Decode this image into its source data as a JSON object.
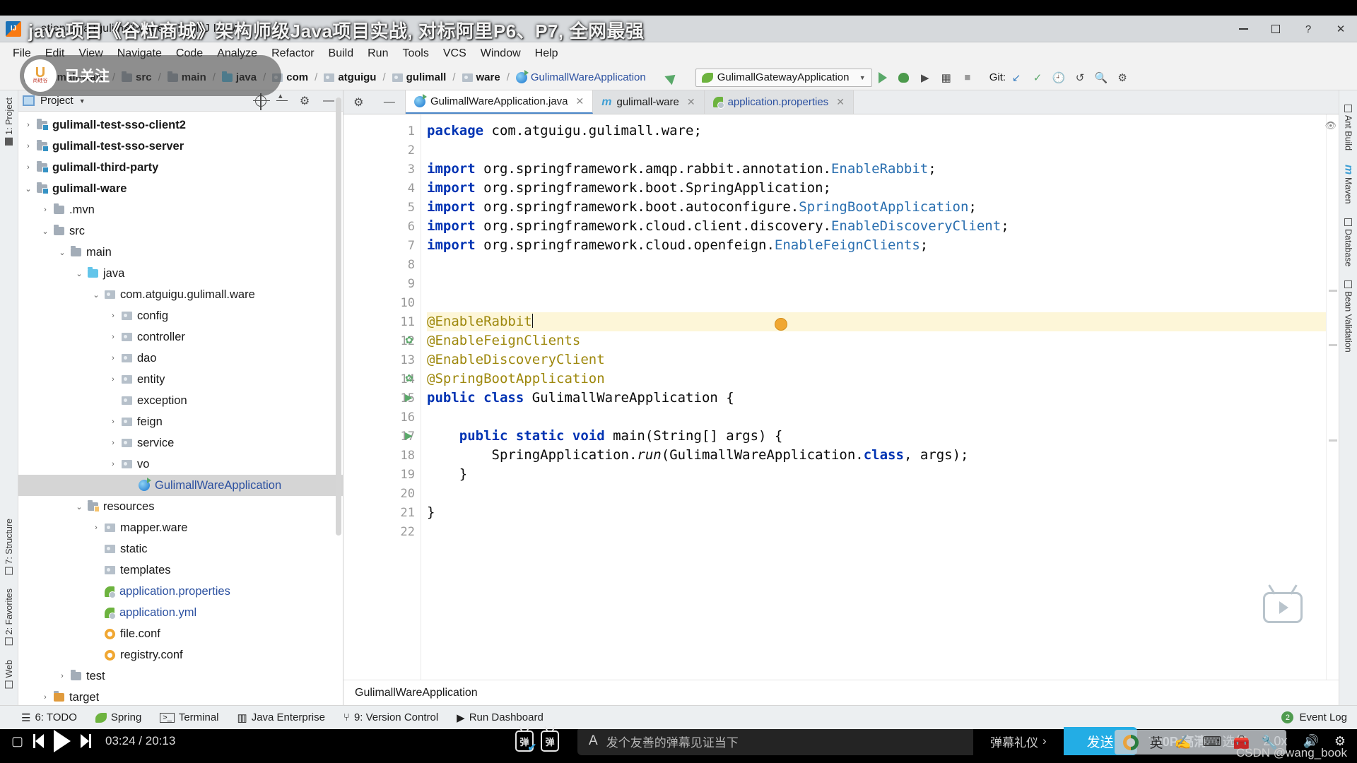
{
  "window": {
    "title": "...ation.java [gulimall-ware] - IntelliJ IDEA",
    "app_icon": "intellij-idea-logo",
    "minimize": "–",
    "maximize": "□",
    "help": "?",
    "close": "✕"
  },
  "menubar": {
    "items": [
      {
        "label": "File"
      },
      {
        "label": "Edit"
      },
      {
        "label": "View"
      },
      {
        "label": "Navigate"
      },
      {
        "label": "Code"
      },
      {
        "label": "Analyze"
      },
      {
        "label": "Refactor"
      },
      {
        "label": "Build"
      },
      {
        "label": "Run"
      },
      {
        "label": "Tools"
      },
      {
        "label": "VCS"
      },
      {
        "label": "Window"
      },
      {
        "label": "Help"
      }
    ]
  },
  "navbar": {
    "breadcrumbs": [
      {
        "label": "gulimall-ware",
        "icon": "module-folder-icon",
        "bold": true
      },
      {
        "label": "src",
        "icon": "folder-icon",
        "bold": true
      },
      {
        "label": "main",
        "icon": "folder-icon",
        "bold": true
      },
      {
        "label": "java",
        "icon": "source-folder-icon",
        "bold": true
      },
      {
        "label": "com",
        "icon": "package-icon",
        "bold": true
      },
      {
        "label": "atguigu",
        "icon": "package-icon",
        "bold": true
      },
      {
        "label": "gulimall",
        "icon": "package-icon",
        "bold": true
      },
      {
        "label": "ware",
        "icon": "package-icon",
        "bold": true
      },
      {
        "label": "GulimallWareApplication",
        "icon": "java-class-icon",
        "bold": false
      }
    ],
    "run_config": "GulimallGatewayApplication",
    "git_label": "Git:"
  },
  "project_panel": {
    "title": "Project",
    "tree": [
      {
        "label": "gulimall-test-sso-client2",
        "arrow": "collapsed",
        "indent": 1,
        "icon": "module-folder-icon",
        "bold": true
      },
      {
        "label": "gulimall-test-sso-server",
        "arrow": "collapsed",
        "indent": 1,
        "icon": "module-folder-icon",
        "bold": true
      },
      {
        "label": "gulimall-third-party",
        "arrow": "collapsed",
        "indent": 1,
        "icon": "module-folder-icon",
        "bold": true
      },
      {
        "label": "gulimall-ware",
        "arrow": "expanded",
        "indent": 1,
        "icon": "module-folder-icon",
        "bold": true
      },
      {
        "label": ".mvn",
        "arrow": "collapsed",
        "indent": 2,
        "icon": "folder-icon",
        "bold": false
      },
      {
        "label": "src",
        "arrow": "expanded",
        "indent": 2,
        "icon": "folder-icon",
        "bold": false
      },
      {
        "label": "main",
        "arrow": "expanded",
        "indent": 3,
        "icon": "folder-icon",
        "bold": false
      },
      {
        "label": "java",
        "arrow": "expanded",
        "indent": 4,
        "icon": "source-folder-icon",
        "bold": false
      },
      {
        "label": "com.atguigu.gulimall.ware",
        "arrow": "expanded",
        "indent": 5,
        "icon": "package-icon",
        "bold": false
      },
      {
        "label": "config",
        "arrow": "collapsed",
        "indent": 6,
        "icon": "package-icon",
        "bold": false
      },
      {
        "label": "controller",
        "arrow": "collapsed",
        "indent": 6,
        "icon": "package-icon",
        "bold": false
      },
      {
        "label": "dao",
        "arrow": "collapsed",
        "indent": 6,
        "icon": "package-icon",
        "bold": false
      },
      {
        "label": "entity",
        "arrow": "collapsed",
        "indent": 6,
        "icon": "package-icon",
        "bold": false
      },
      {
        "label": "exception",
        "arrow": "none",
        "indent": 6,
        "icon": "package-icon",
        "bold": false
      },
      {
        "label": "feign",
        "arrow": "collapsed",
        "indent": 6,
        "icon": "package-icon",
        "bold": false
      },
      {
        "label": "service",
        "arrow": "collapsed",
        "indent": 6,
        "icon": "package-icon",
        "bold": false
      },
      {
        "label": "vo",
        "arrow": "collapsed",
        "indent": 6,
        "icon": "package-icon",
        "bold": false
      },
      {
        "label": "GulimallWareApplication",
        "arrow": "none",
        "indent": 7,
        "icon": "java-class-icon",
        "bold": false,
        "selected": true,
        "link": true
      },
      {
        "label": "resources",
        "arrow": "expanded",
        "indent": 4,
        "icon": "resources-folder-icon",
        "bold": false
      },
      {
        "label": "mapper.ware",
        "arrow": "collapsed",
        "indent": 5,
        "icon": "package-icon",
        "bold": false
      },
      {
        "label": "static",
        "arrow": "none",
        "indent": 5,
        "icon": "package-icon",
        "bold": false
      },
      {
        "label": "templates",
        "arrow": "none",
        "indent": 5,
        "icon": "package-icon",
        "bold": false
      },
      {
        "label": "application.properties",
        "arrow": "none",
        "indent": 5,
        "icon": "spring-config-icon",
        "bold": false,
        "link": true
      },
      {
        "label": "application.yml",
        "arrow": "none",
        "indent": 5,
        "icon": "spring-config-icon",
        "bold": false,
        "link": true
      },
      {
        "label": "file.conf",
        "arrow": "none",
        "indent": 5,
        "icon": "conf-file-icon",
        "bold": false
      },
      {
        "label": "registry.conf",
        "arrow": "none",
        "indent": 5,
        "icon": "conf-file-icon",
        "bold": false
      },
      {
        "label": "test",
        "arrow": "collapsed",
        "indent": 3,
        "icon": "folder-icon",
        "bold": false
      },
      {
        "label": "target",
        "arrow": "collapsed",
        "indent": 2,
        "icon": "target-folder-icon",
        "bold": false
      }
    ]
  },
  "left_tool_strip": [
    {
      "label": "1: Project",
      "name": "tool-window-project"
    },
    {
      "label": "7: Structure",
      "name": "tool-window-structure"
    },
    {
      "label": "2: Favorites",
      "name": "tool-window-favorites"
    },
    {
      "label": "Web",
      "name": "tool-window-web"
    }
  ],
  "right_tool_strip": [
    {
      "label": "Ant Build",
      "name": "tool-window-ant-build"
    },
    {
      "label": "Maven",
      "name": "tool-window-maven"
    },
    {
      "label": "Database",
      "name": "tool-window-database"
    },
    {
      "label": "Bean Validation",
      "name": "tool-window-bean-validation"
    }
  ],
  "editor": {
    "tabs": [
      {
        "label": "GulimallWareApplication.java",
        "icon": "java-class-icon",
        "active": true,
        "closeable": true
      },
      {
        "label": "gulimall-ware",
        "icon": "maven-module-icon",
        "active": false,
        "closeable": true
      },
      {
        "label": "application.properties",
        "icon": "spring-config-icon",
        "active": false,
        "closeable": true,
        "link": true
      }
    ],
    "line_numbers": [
      "1",
      "2",
      "3",
      "4",
      "5",
      "6",
      "7",
      "8",
      "9",
      "10",
      "11",
      "12",
      "13",
      "14",
      "15",
      "16",
      "17",
      "18",
      "19",
      "20",
      "21",
      "22"
    ],
    "lines": [
      {
        "n": 1,
        "html": "<span class='kw'>package</span> com.atguigu.gulimall.ware;"
      },
      {
        "n": 2,
        "html": ""
      },
      {
        "n": 3,
        "html": "<span class='kw'>import</span> org.springframework.amqp.rabbit.annotation.<span class='cls'>EnableRabbit</span>;"
      },
      {
        "n": 4,
        "html": "<span class='kw'>import</span> org.springframework.boot.SpringApplication;"
      },
      {
        "n": 5,
        "html": "<span class='kw'>import</span> org.springframework.boot.autoconfigure.<span class='cls'>SpringBootApplication</span>;"
      },
      {
        "n": 6,
        "html": "<span class='kw'>import</span> org.springframework.cloud.client.discovery.<span class='cls'>EnableDiscoveryClient</span>;"
      },
      {
        "n": 7,
        "html": "<span class='kw'>import</span> org.springframework.cloud.openfeign.<span class='cls'>EnableFeignClients</span>;"
      },
      {
        "n": 8,
        "html": ""
      },
      {
        "n": 9,
        "html": ""
      },
      {
        "n": 10,
        "html": ""
      },
      {
        "n": 11,
        "html": "<span class='anno'>@EnableRabbit</span><span class='cursor'></span>",
        "highlight": true
      },
      {
        "n": 12,
        "html": "<span class='anno'>@EnableFeignClients</span>"
      },
      {
        "n": 13,
        "html": "<span class='anno'>@EnableDiscoveryClient</span>"
      },
      {
        "n": 14,
        "html": "<span class='anno'>@SpringBootApplication</span>"
      },
      {
        "n": 15,
        "html": "<span class='kw'>public class</span> GulimallWareApplication {"
      },
      {
        "n": 16,
        "html": ""
      },
      {
        "n": 17,
        "html": "    <span class='kw'>public static void</span> main(String[] args) {"
      },
      {
        "n": 18,
        "html": "        SpringApplication.<span class='it'>run</span>(GulimallWareApplication.<span class='kw'>class</span>, args);"
      },
      {
        "n": 19,
        "html": "    }"
      },
      {
        "n": 20,
        "html": ""
      },
      {
        "n": 21,
        "html": "}"
      },
      {
        "n": 22,
        "html": ""
      }
    ],
    "breadcrumb_status": "GulimallWareApplication"
  },
  "bottom_toolbar": {
    "items": [
      {
        "label": "6: TODO",
        "icon": "todo-icon"
      },
      {
        "label": "Spring",
        "icon": "spring-leaf-icon"
      },
      {
        "label": "Terminal",
        "icon": "terminal-icon"
      },
      {
        "label": "Java Enterprise",
        "icon": "java-enterprise-icon"
      },
      {
        "label": "9: Version Control",
        "icon": "version-control-icon"
      },
      {
        "label": "Run Dashboard",
        "icon": "run-dashboard-icon"
      }
    ],
    "event_log": {
      "label": "Event Log",
      "count": "2"
    }
  },
  "video_overlay": {
    "title": "java项目《谷粒商城》架构师级Java项目实战, 对标阿里P6、P7, 全网最强",
    "follow_chip": {
      "label": "已关注",
      "avatar_glyph": "U",
      "avatar_sub": "尚硅谷"
    },
    "watermark": "CSDN @wang_book"
  },
  "player": {
    "prev_icon": "previous-icon",
    "play_icon": "play-icon",
    "next_icon": "next-icon",
    "picture_in_picture_icon": "pip-icon",
    "current_time": "03:24",
    "total_time": "20:13",
    "time_separator": "/",
    "danmu_toggle_icon": "danmaku-on-icon",
    "danmu_settings_icon": "danmaku-settings-icon",
    "style_icon": "A",
    "input_placeholder": "发个友善的弹幕见证当下",
    "etiquette_label": "弹幕礼仪",
    "etiquette_caret": "›",
    "send_label": "发送",
    "quality": "720P 高清",
    "episodes": "选集",
    "speed": "2.0x",
    "volume_icon": "volume-icon",
    "settings_icon": "settings-icon",
    "scrub_overlay": "ypo: In  ord 'G  imall'"
  },
  "ime_tray": {
    "sogou_icon": "sogou-pinyin-icon",
    "lang": "英",
    "hand_icon": "handwriting-icon",
    "keyboard_icon": "soft-keyboard-icon",
    "toolbox_icon": "toolbox-icon",
    "wrench_icon": "wrench-icon"
  }
}
